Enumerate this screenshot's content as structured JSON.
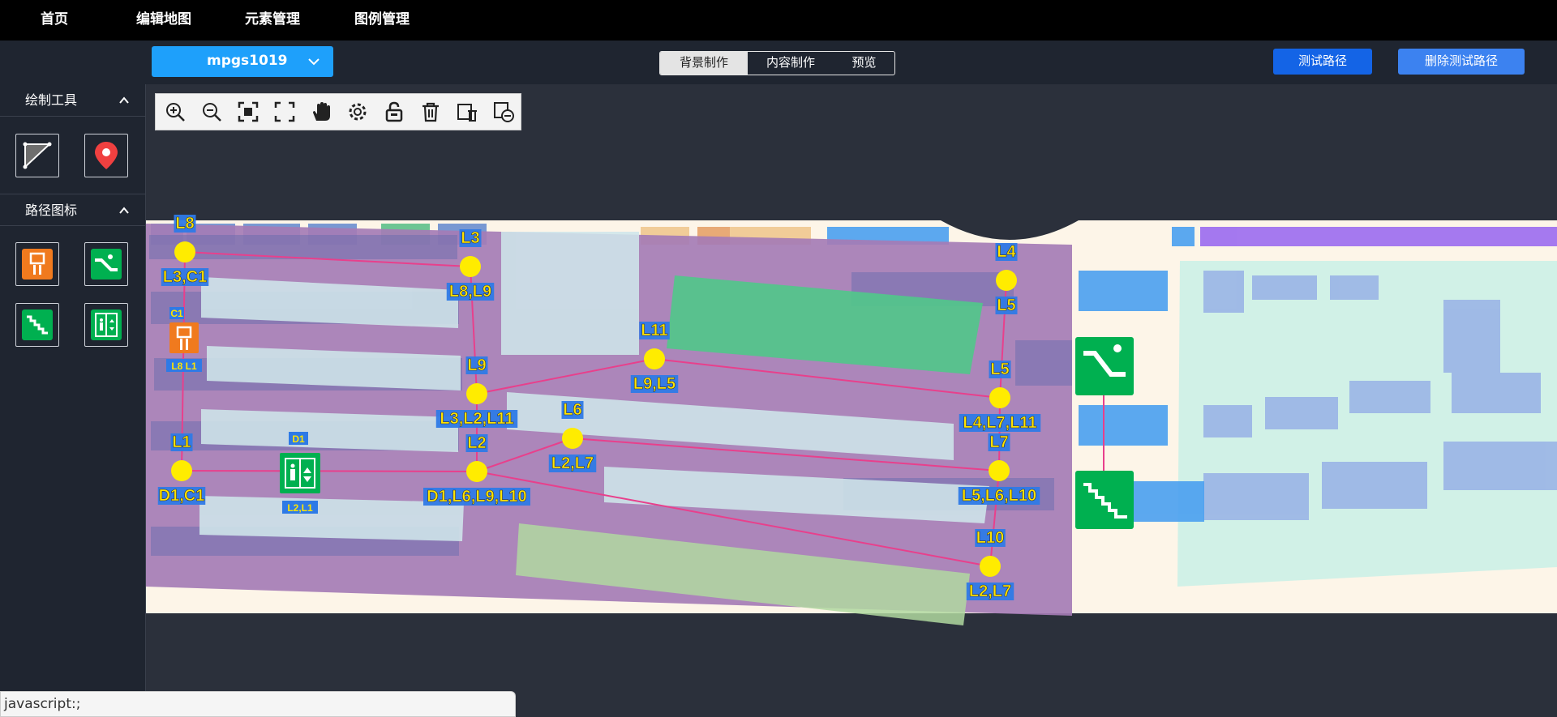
{
  "nav": {
    "items": [
      "首页",
      "编辑地图",
      "元素管理",
      "图例管理"
    ]
  },
  "toolbar": {
    "map_select": "mpgs1019",
    "modes": [
      "背景制作",
      "内容制作",
      "预览"
    ],
    "active_mode": "背景制作",
    "test_path": "测试路径",
    "delete_test_path": "删除测试路径"
  },
  "sidebar": {
    "draw_tools_title": "绘制工具",
    "path_icons_title": "路径图标"
  },
  "controls": [
    "zoom-in-icon",
    "zoom-out-icon",
    "fit-screen-icon",
    "fullscreen-icon",
    "hand-pan-icon",
    "settings-gear-icon",
    "unlock-icon",
    "trash-icon",
    "delete-layer-icon",
    "remove-layer-icon"
  ],
  "map": {
    "nodes": [
      {
        "id": "L8",
        "label": "L8",
        "sub": "L3,C1"
      },
      {
        "id": "L3",
        "label": "L3",
        "sub": "L8,L9"
      },
      {
        "id": "L4",
        "label": "L4",
        "sub": "L5"
      },
      {
        "id": "L11",
        "label": "L11",
        "sub": "L9,L5"
      },
      {
        "id": "L9",
        "label": "L9",
        "sub": "L3,L2,L11"
      },
      {
        "id": "L5",
        "label": "L5",
        "sub": "L4,L7,L11"
      },
      {
        "id": "L6",
        "label": "L6",
        "sub": "L2,L7"
      },
      {
        "id": "L1",
        "label": "L1",
        "sub": "D1,C1"
      },
      {
        "id": "L2",
        "label": "L2",
        "sub": "D1,L6,L9,L10"
      },
      {
        "id": "L7",
        "label": "L7",
        "sub": "L5,L6,L10"
      },
      {
        "id": "L10",
        "label": "L10",
        "sub": "L2,L7"
      }
    ],
    "special_nodes": [
      {
        "id": "C1",
        "label": "C1",
        "sub": "L8 L1",
        "icon": "elevator-icon"
      },
      {
        "id": "D1",
        "label": "D1",
        "sub": "L2,L1",
        "icon": "lift-icon"
      }
    ],
    "colors": {
      "path": "#e8408c",
      "node": "#ffec00",
      "label_bg": "#2e7ae6",
      "label_text": "#ffe400",
      "zone": "#a878b8",
      "green": "#00b050",
      "orange": "#f07a1e"
    }
  },
  "status": {
    "text": "javascript:;"
  }
}
